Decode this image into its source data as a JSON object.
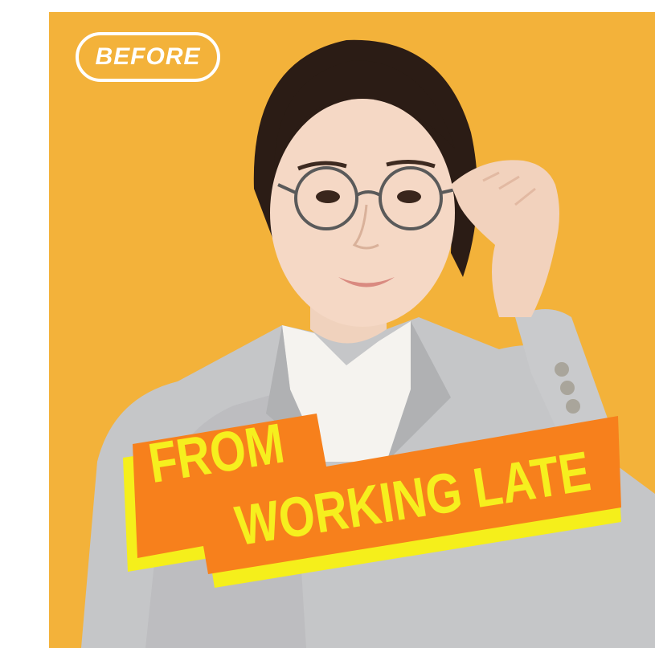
{
  "badge": {
    "label": "BEFORE"
  },
  "banner": {
    "line1": "FROM",
    "line2": "WORKING LATE"
  },
  "colors": {
    "background": "#f3b23a",
    "banner_fill": "#f7801c",
    "banner_shadow": "#f5ef1b",
    "banner_text": "#f6ef1e",
    "badge_outline": "#ffffff",
    "blazer": "#c5c6c8"
  },
  "image": {
    "subject": "woman-adjusting-glasses-photo"
  }
}
